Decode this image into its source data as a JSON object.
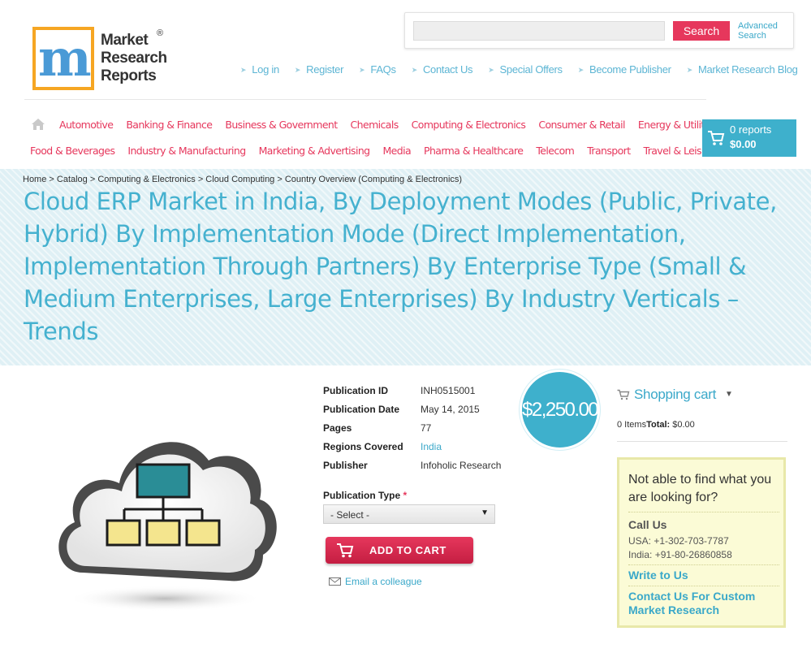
{
  "logo": {
    "line1": "Market",
    "line2": "Research",
    "line3": "Reports",
    "registered": "®",
    "colors": {
      "border": "#f6a623",
      "m_blue": "#4a9ad6",
      "m_green": "#5cae3e"
    }
  },
  "search": {
    "placeholder": "",
    "button_label": "Search",
    "advanced_label_1": "Advanced",
    "advanced_label_2": "Search"
  },
  "top_links": [
    "Log in",
    "Register",
    "FAQs",
    "Contact Us",
    "Special Offers",
    "Become Publisher",
    "Market Research Blog"
  ],
  "categories": {
    "row1": [
      "Automotive",
      "Banking & Finance",
      "Business & Government",
      "Chemicals",
      "Computing & Electronics",
      "Consumer & Retail",
      "Energy & Utilities"
    ],
    "row2": [
      "Food & Beverages",
      "Industry & Manufacturing",
      "Marketing & Advertising",
      "Media",
      "Pharma & Healthcare",
      "Telecom",
      "Transport",
      "Travel & Leisure"
    ]
  },
  "header_cart": {
    "count": "0 reports",
    "total": "$0.00"
  },
  "breadcrumb": "Home > Catalog > Computing & Electronics > Cloud Computing > Country Overview (Computing & Electronics)",
  "title": "Cloud ERP Market in India, By Deployment Modes (Public, Private, Hybrid) By Implementation Mode (Direct Implementation, Implementation Through Partners) By Enterprise Type (Small & Medium Enterprises, Large Enterprises) By Industry Verticals – Trends",
  "details": [
    {
      "label": "Publication ID",
      "value": "INH0515001"
    },
    {
      "label": "Publication Date",
      "value": "May 14, 2015"
    },
    {
      "label": "Pages",
      "value": "77"
    },
    {
      "label": "Regions Covered",
      "value": "India"
    },
    {
      "label": "Publisher",
      "value": "Infoholic Research"
    }
  ],
  "price": "$2,250.00",
  "publication_type": {
    "label": "Publication Type",
    "required_mark": "*",
    "selected": "- Select -"
  },
  "add_to_cart_label": "ADD TO CART",
  "email_label": "Email a colleague",
  "shopping_cart": {
    "title": "Shopping cart",
    "items": "0 Items",
    "total_label": "Total:",
    "total_value": "$0.00"
  },
  "help": {
    "title": "Not able to find what you are looking for?",
    "call_heading": "Call Us",
    "usa_phone": "USA: +1-302-703-7787",
    "india_phone": "India: +91-80-26860858",
    "write_link": "Write to Us",
    "custom_link": "Contact Us For Custom Market Research"
  },
  "colors": {
    "accent_pink": "#e6375c",
    "accent_blue": "#3eb0cc",
    "title_blue": "#45b1cf",
    "help_bg": "#fbfbd6"
  }
}
